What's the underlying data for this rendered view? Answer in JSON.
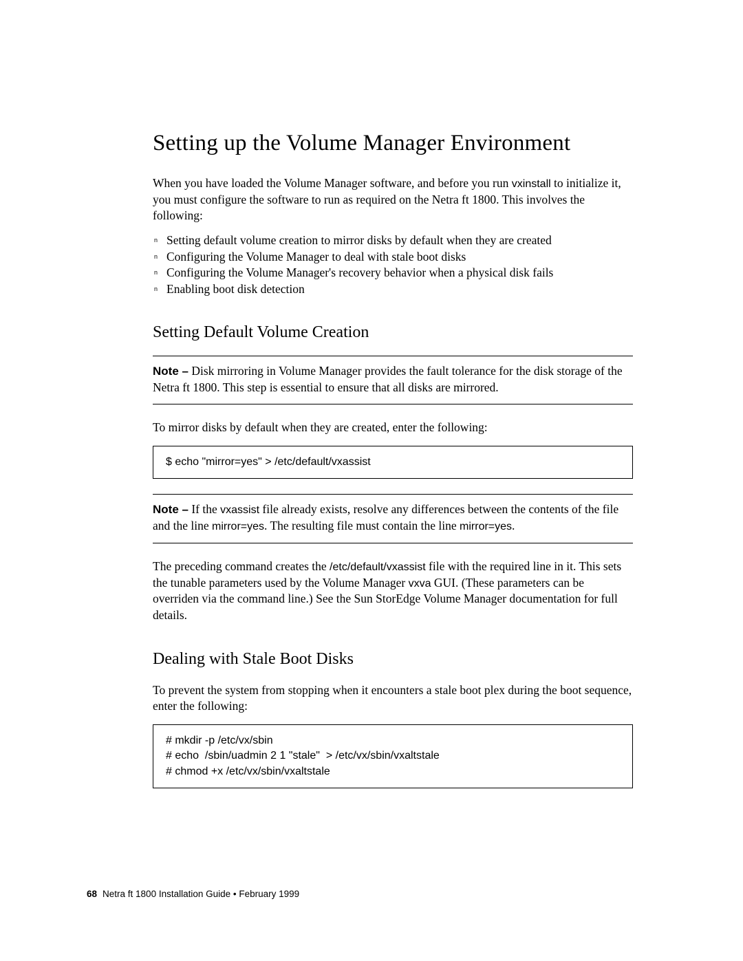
{
  "title": "Setting up the Volume Manager Environment",
  "intro": {
    "line1": "When you have loaded the Volume Manager software, and before you run",
    "cmd": "vxinstall",
    "line2_rest": " to initialize it, you must configure the software to run as required on the Netra ft 1800. This involves the following:"
  },
  "bullets": [
    "Setting default volume creation to mirror disks by default when they are created",
    "Configuring the Volume Manager to deal with stale boot disks",
    "Configuring the Volume Manager's recovery behavior when a physical disk fails",
    "Enabling boot disk detection"
  ],
  "section1": {
    "heading": "Setting Default Volume Creation",
    "note1_label": "Note –",
    "note1_body": " Disk mirroring in Volume Manager provides the fault tolerance for the disk storage of the Netra ft 1800. This step is essential to ensure that all disks are mirrored.",
    "para1": "To mirror disks by default when they are created, enter the following:",
    "code1": "$ echo \"mirror=yes\" > /etc/default/vxassist",
    "note2_label": "Note –",
    "note2_pre": " If the ",
    "note2_cmd1": "vxassist",
    "note2_mid": " file already exists, resolve any differences between the contents of the file and the line ",
    "note2_cmd2": "mirror=yes",
    "note2_mid2": ". The resulting file must contain the line ",
    "note2_cmd3": "mirror=yes",
    "note2_end": ".",
    "para2_pre": "The preceding command creates the ",
    "para2_path": "/etc/default/vxassist",
    "para2_mid": " file with the required line in it. This sets the tunable parameters used by the Volume Manager ",
    "para2_cmd": "vxva",
    "para2_end": " GUI. (These parameters can be overriden via the command line.) See the Sun StorEdge Volume Manager documentation for full details."
  },
  "section2": {
    "heading": "Dealing with Stale Boot Disks",
    "para1": "To prevent the system from stopping when it encounters a stale boot plex during the boot sequence, enter the following:",
    "code1": "# mkdir -p /etc/vx/sbin\n# echo  /sbin/uadmin 2 1 \"stale\"  > /etc/vx/sbin/vxaltstale\n# chmod +x /etc/vx/sbin/vxaltstale"
  },
  "footer": {
    "page_num": "68",
    "text": "Netra ft 1800 Installation Guide  •  February 1999"
  }
}
